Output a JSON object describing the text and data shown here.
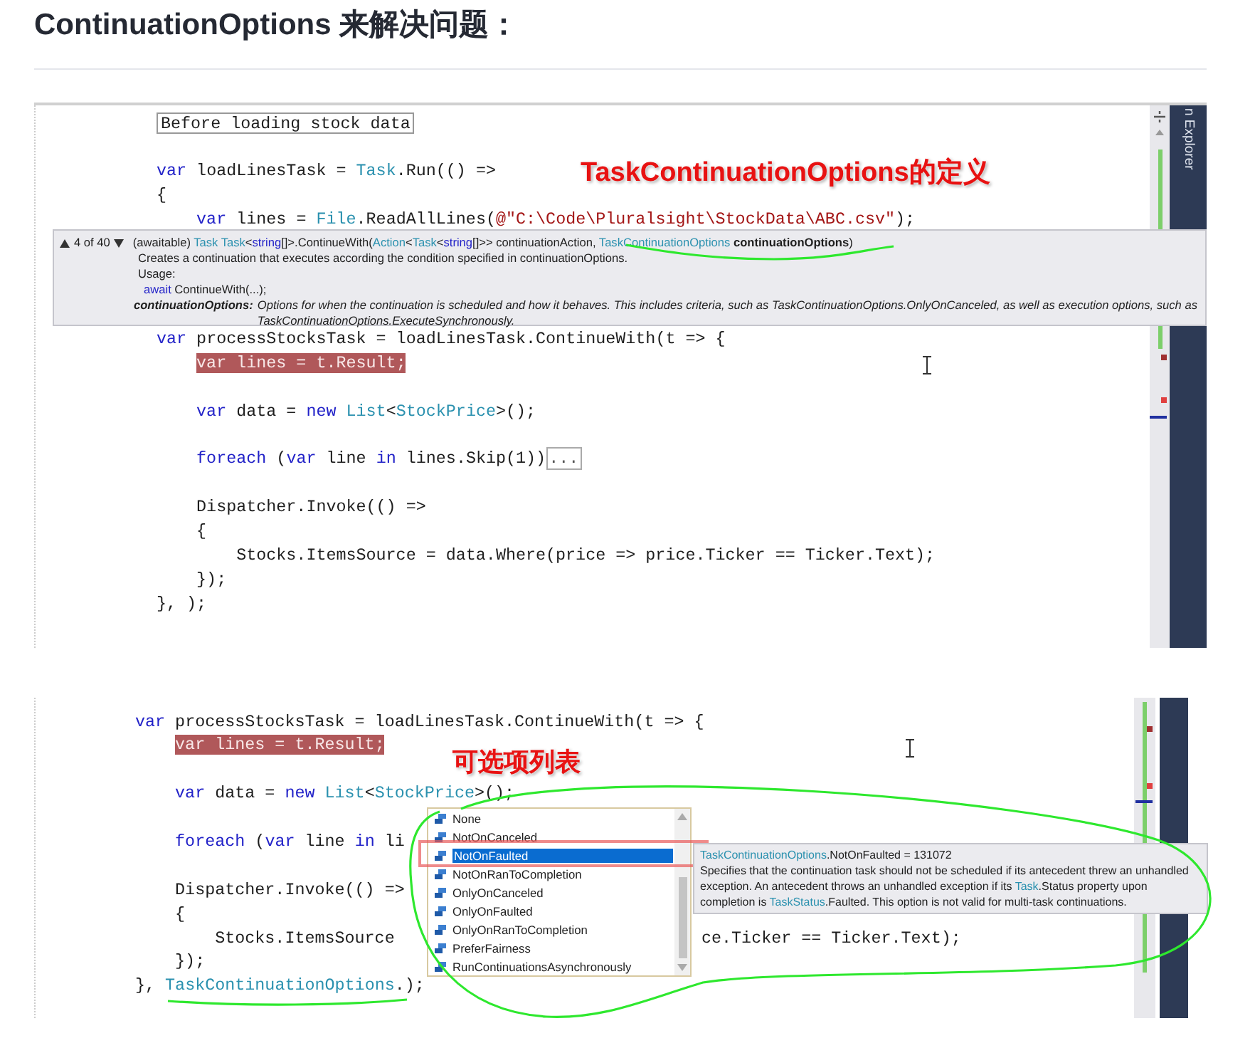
{
  "heading": "ContinuationOptions 来解决问题：",
  "screenshot_1": {
    "annotation": "TaskContinuationOptions的定义",
    "side_tab": "n Explorer",
    "lines": [
      {
        "kind": "collapsed",
        "tokens": [
          {
            "kind": "plain",
            "text": "Before loading stock data"
          }
        ]
      },
      {
        "kind": "blank"
      },
      {
        "kind": "code",
        "tokens": [
          {
            "kind": "keyword",
            "text": "var"
          },
          {
            "kind": "plain",
            "text": " loadLinesTask = "
          },
          {
            "kind": "type",
            "text": "Task"
          },
          {
            "kind": "plain",
            "text": ".Run(() =>"
          }
        ]
      },
      {
        "kind": "code",
        "tokens": [
          {
            "kind": "plain",
            "text": "{"
          }
        ],
        "children": [
          {
            "kind": "code",
            "tokens": [
              {
                "kind": "keyword",
                "text": "var"
              },
              {
                "kind": "plain",
                "text": " lines = "
              },
              {
                "kind": "type",
                "text": "File"
              },
              {
                "kind": "plain",
                "text": ".ReadAllLines("
              },
              {
                "kind": "string",
                "text": "@\"C:\\Code\\Pluralsight\\StockData\\ABC.csv\""
              },
              {
                "kind": "plain",
                "text": ");"
              }
            ]
          },
          {
            "kind": "blank"
          },
          {
            "kind": "blank"
          },
          {
            "kind": "blank"
          },
          {
            "kind": "blank"
          }
        ]
      },
      {
        "kind": "code",
        "tokens": [
          {
            "kind": "keyword",
            "text": "var"
          },
          {
            "kind": "plain",
            "text": " processStocksTask = loadLinesTask.ContinueWith(t => {"
          }
        ],
        "children": [
          {
            "kind": "code",
            "tokens": [
              {
                "kind": "error",
                "text": "var lines = t.Result;"
              }
            ]
          },
          {
            "kind": "blank"
          },
          {
            "kind": "code",
            "tokens": [
              {
                "kind": "keyword",
                "text": "var"
              },
              {
                "kind": "plain",
                "text": " data = "
              },
              {
                "kind": "keyword",
                "text": "new "
              },
              {
                "kind": "type",
                "text": "List"
              },
              {
                "kind": "plain",
                "text": "<"
              },
              {
                "kind": "type",
                "text": "StockPrice"
              },
              {
                "kind": "plain",
                "text": ">();"
              }
            ]
          },
          {
            "kind": "blank"
          },
          {
            "kind": "code",
            "tokens": [
              {
                "kind": "keyword",
                "text": "foreach"
              },
              {
                "kind": "plain",
                "text": " ("
              },
              {
                "kind": "keyword",
                "text": "var"
              },
              {
                "kind": "plain",
                "text": " line "
              },
              {
                "kind": "keyword",
                "text": "in"
              },
              {
                "kind": "plain",
                "text": " lines.Skip(1))"
              },
              {
                "kind": "fold",
                "text": "..."
              }
            ]
          },
          {
            "kind": "blank"
          },
          {
            "kind": "code",
            "tokens": [
              {
                "kind": "plain",
                "text": "Dispatcher.Invoke(() =>"
              }
            ]
          },
          {
            "kind": "code",
            "tokens": [
              {
                "kind": "plain",
                "text": "{"
              }
            ],
            "children": [
              {
                "kind": "code",
                "tokens": [
                  {
                    "kind": "plain",
                    "text": "Stocks.ItemsSource = data.Where(price => price.Ticker == Ticker.Text);"
                  }
                ]
              }
            ]
          },
          {
            "kind": "code",
            "tokens": [
              {
                "kind": "plain",
                "text": "});"
              }
            ]
          }
        ]
      },
      {
        "kind": "code",
        "tokens": [
          {
            "kind": "plain",
            "text": "}, );"
          }
        ]
      },
      {
        "kind": "blank"
      }
    ],
    "signature_help": {
      "counter": "4 of 40",
      "signature": [
        {
          "kind": "plain",
          "text": "(awaitable) "
        },
        {
          "kind": "type",
          "text": "Task "
        },
        {
          "kind": "type",
          "text": "Task"
        },
        {
          "kind": "plain",
          "text": "<"
        },
        {
          "kind": "keyword",
          "text": "string"
        },
        {
          "kind": "plain",
          "text": "[]>.ContinueWith("
        },
        {
          "kind": "type",
          "text": "Action"
        },
        {
          "kind": "plain",
          "text": "<"
        },
        {
          "kind": "type",
          "text": "Task"
        },
        {
          "kind": "plain",
          "text": "<"
        },
        {
          "kind": "keyword",
          "text": "string"
        },
        {
          "kind": "plain",
          "text": "[]>> continuationAction, "
        },
        {
          "kind": "type",
          "text": "TaskContinuationOptions "
        },
        {
          "kind": "param",
          "text": "continuationOptions"
        },
        {
          "kind": "plain",
          "text": ")"
        }
      ],
      "summary": "Creates a continuation that executes according the condition specified in continuationOptions.",
      "usage_label": "Usage:",
      "usage": [
        {
          "kind": "keyword",
          "text": "await"
        },
        {
          "kind": "plain",
          "text": " ContinueWith(...);"
        }
      ],
      "param_name": "continuationOptions:",
      "param_description": "Options for when the continuation is scheduled and how it behaves. This includes criteria, such as TaskContinuationOptions.OnlyOnCanceled, as well as execution options, such as TaskContinuationOptions.ExecuteSynchronously."
    }
  },
  "screenshot_2": {
    "annotation": "可选项列表",
    "lines": [
      {
        "kind": "code",
        "tokens": [
          {
            "kind": "keyword",
            "text": "var"
          },
          {
            "kind": "plain",
            "text": " processStocksTask = loadLinesTask.ContinueWith(t => {"
          }
        ],
        "children": [
          {
            "kind": "code",
            "tokens": [
              {
                "kind": "error",
                "text": "var lines = t.Result;"
              }
            ]
          },
          {
            "kind": "blank"
          },
          {
            "kind": "code",
            "tokens": [
              {
                "kind": "keyword",
                "text": "var"
              },
              {
                "kind": "plain",
                "text": " data = "
              },
              {
                "kind": "keyword",
                "text": "new "
              },
              {
                "kind": "type",
                "text": "List"
              },
              {
                "kind": "plain",
                "text": "<"
              },
              {
                "kind": "type",
                "text": "StockPrice"
              },
              {
                "kind": "plain",
                "text": ">();"
              }
            ]
          },
          {
            "kind": "blank"
          },
          {
            "kind": "code",
            "tokens": [
              {
                "kind": "keyword",
                "text": "foreach"
              },
              {
                "kind": "plain",
                "text": " ("
              },
              {
                "kind": "keyword",
                "text": "var"
              },
              {
                "kind": "plain",
                "text": " line "
              },
              {
                "kind": "keyword",
                "text": "in"
              },
              {
                "kind": "plain",
                "text": " li"
              }
            ]
          },
          {
            "kind": "blank"
          },
          {
            "kind": "code",
            "tokens": [
              {
                "kind": "plain",
                "text": "Dispatcher.Invoke(() =>"
              }
            ]
          },
          {
            "kind": "code",
            "tokens": [
              {
                "kind": "plain",
                "text": "{"
              }
            ],
            "children": [
              {
                "kind": "code",
                "tokens": [
                  {
                    "kind": "plain",
                    "text": "Stocks.ItemsSource"
                  },
                  {
                    "kind": "tail",
                    "text": "ce.Ticker == Ticker.Text);"
                  }
                ]
              }
            ]
          },
          {
            "kind": "code",
            "tokens": [
              {
                "kind": "plain",
                "text": "});"
              }
            ]
          }
        ]
      },
      {
        "kind": "code",
        "tokens": [
          {
            "kind": "plain",
            "text": "}, "
          },
          {
            "kind": "type",
            "text": "TaskContinuationOptions"
          },
          {
            "kind": "plain",
            "text": ".);"
          }
        ]
      }
    ],
    "completion_list": {
      "items": [
        {
          "label": "None",
          "selected": false
        },
        {
          "label": "NotOnCanceled",
          "selected": false
        },
        {
          "label": "NotOnFaulted",
          "selected": true
        },
        {
          "label": "NotOnRanToCompletion",
          "selected": false
        },
        {
          "label": "OnlyOnCanceled",
          "selected": false
        },
        {
          "label": "OnlyOnFaulted",
          "selected": false
        },
        {
          "label": "OnlyOnRanToCompletion",
          "selected": false
        },
        {
          "label": "PreferFairness",
          "selected": false
        },
        {
          "label": "RunContinuationsAsynchronously",
          "selected": false
        }
      ]
    },
    "quick_info": {
      "title": [
        {
          "kind": "type",
          "text": "TaskContinuationOptions"
        },
        {
          "kind": "plain",
          "text": ".NotOnFaulted = 131072"
        }
      ],
      "description": [
        {
          "kind": "plain",
          "text": "Specifies that the continuation task should not be scheduled if its antecedent threw an unhandled exception. An antecedent throws an unhandled exception if its "
        },
        {
          "kind": "type",
          "text": "Task"
        },
        {
          "kind": "plain",
          "text": ".Status property upon completion is "
        },
        {
          "kind": "type",
          "text": "TaskStatus"
        },
        {
          "kind": "plain",
          "text": ".Faulted. This option is not valid for multi-task continuations."
        }
      ]
    }
  }
}
